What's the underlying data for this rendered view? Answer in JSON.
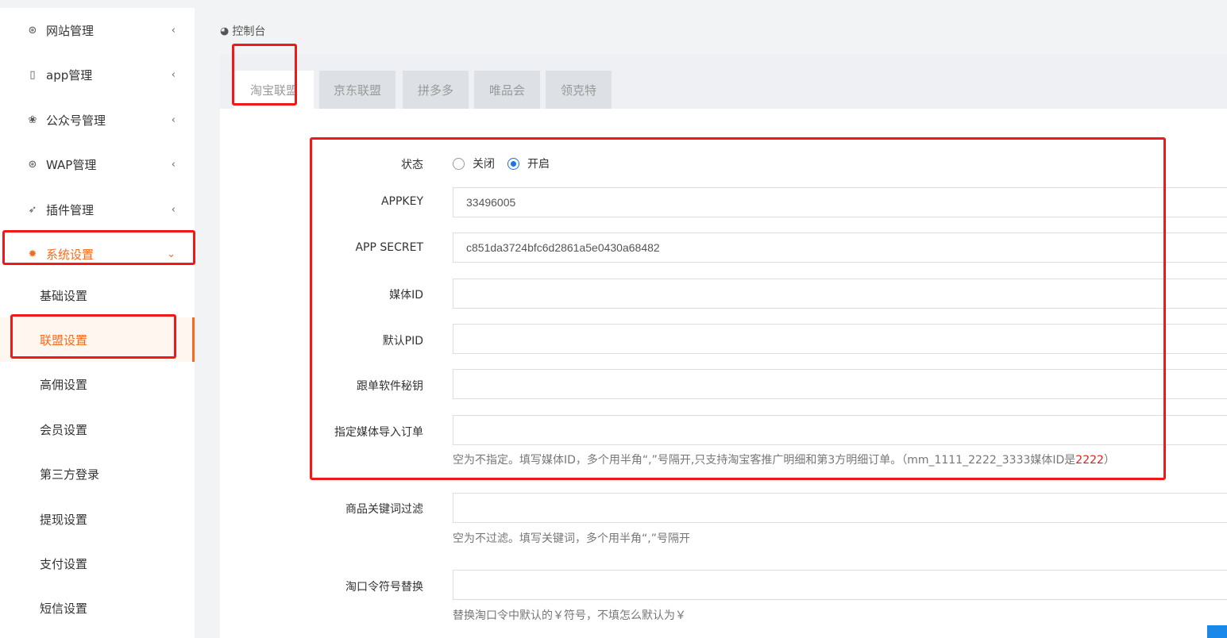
{
  "sidebar": {
    "menu": [
      {
        "label": "网站管理",
        "icon": "globe-icon",
        "glyph": "⊛",
        "chevron": "‹"
      },
      {
        "label": "app管理",
        "icon": "mobile-icon",
        "glyph": "▯",
        "chevron": "‹"
      },
      {
        "label": "公众号管理",
        "icon": "wechat-icon",
        "glyph": "❀",
        "chevron": "‹"
      },
      {
        "label": "WAP管理",
        "icon": "lifebuoy-icon",
        "glyph": "⊛",
        "chevron": "‹"
      },
      {
        "label": "插件管理",
        "icon": "rocket-icon",
        "glyph": "➶",
        "chevron": "‹"
      },
      {
        "label": "系统设置",
        "icon": "gear-icon",
        "glyph": "✹",
        "chevron": "⌄",
        "active": true
      }
    ],
    "submenu": [
      {
        "label": "基础设置"
      },
      {
        "label": "联盟设置",
        "active": true
      },
      {
        "label": "高佣设置"
      },
      {
        "label": "会员设置"
      },
      {
        "label": "第三方登录"
      },
      {
        "label": "提现设置"
      },
      {
        "label": "支付设置"
      },
      {
        "label": "短信设置"
      }
    ]
  },
  "breadcrumb": {
    "icon": "dashboard-icon",
    "glyph": "◕",
    "label": "控制台"
  },
  "tabs": [
    {
      "label": "淘宝联盟",
      "active": true
    },
    {
      "label": "京东联盟"
    },
    {
      "label": "拼多多"
    },
    {
      "label": "唯品会"
    },
    {
      "label": "领克特"
    }
  ],
  "form": {
    "status": {
      "label": "状态",
      "options": [
        "关闭",
        "开启"
      ],
      "selected": "开启"
    },
    "appkey": {
      "label": "APPKEY",
      "value": "33496005"
    },
    "app_secret": {
      "label": "APP SECRET",
      "value": "c851da3724bfc6d2861a5e0430a68482"
    },
    "media_id": {
      "label": "媒体ID",
      "value": ""
    },
    "default_pid": {
      "label": "默认PID",
      "value": ""
    },
    "tracking_key": {
      "label": "跟单软件秘钥",
      "value": ""
    },
    "import_media": {
      "label": "指定媒体导入订单",
      "value": "",
      "help": "空为不指定。填写媒体ID，多个用半角“,”号隔开,只支持淘宝客推广明细和第3方明细订单。（mm_1111_2222_3333媒体ID是",
      "help_highlight": "2222",
      "help_end": "）"
    },
    "keyword_filter": {
      "label": "商品关键词过滤",
      "value": "",
      "help": "空为不过滤。填写关键词，多个用半角“,”号隔开"
    },
    "tkl_replace": {
      "label": "淘口令符号替换",
      "value": "",
      "help": "替换淘口令中默认的￥符号，不填怎么默认为￥"
    }
  },
  "colors": {
    "accent": "#f26c1f",
    "annotation": "#f21818",
    "radio": "#1a73e8"
  }
}
